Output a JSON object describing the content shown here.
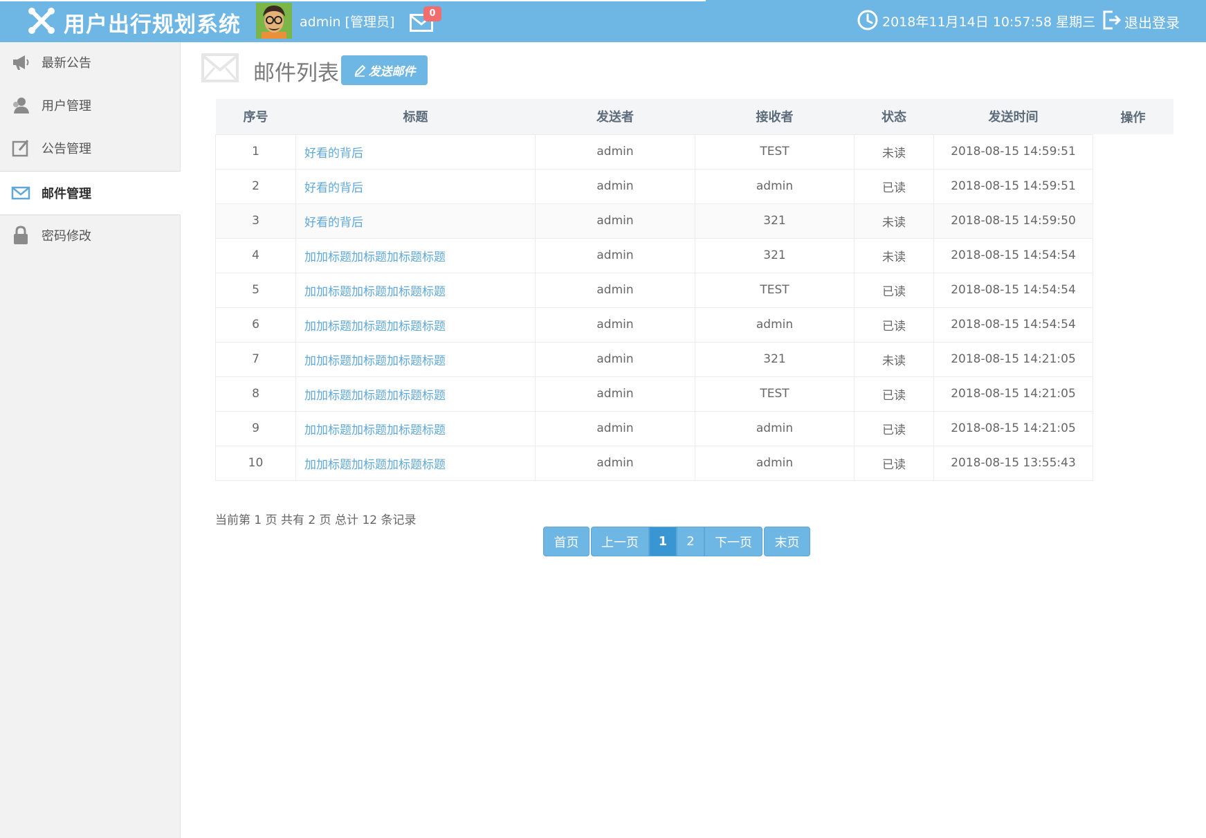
{
  "header": {
    "app_title": "用户出行规划系统",
    "username": "admin [管理员]",
    "mail_count": "0",
    "datetime": "2018年11月14日 10:57:58 星期三",
    "logout_label": "退出登录"
  },
  "sidebar": {
    "items": [
      {
        "label": "最新公告",
        "icon": "megaphone-icon"
      },
      {
        "label": "用户管理",
        "icon": "user-icon"
      },
      {
        "label": "公告管理",
        "icon": "edit-icon"
      },
      {
        "label": "邮件管理",
        "icon": "mail-icon",
        "active": true
      },
      {
        "label": "密码修改",
        "icon": "lock-icon"
      }
    ]
  },
  "main": {
    "title": "邮件列表",
    "send_button": "发送邮件",
    "table": {
      "headers": [
        "序号",
        "标题",
        "发送者",
        "接收者",
        "状态",
        "发送时间",
        "操作"
      ],
      "rows": [
        {
          "no": "1",
          "title": "好看的背后",
          "sender": "admin",
          "receiver": "TEST",
          "status": "未读",
          "time": "2018-08-15 14:59:51"
        },
        {
          "no": "2",
          "title": "好看的背后",
          "sender": "admin",
          "receiver": "admin",
          "status": "已读",
          "time": "2018-08-15 14:59:51"
        },
        {
          "no": "3",
          "title": "好看的背后",
          "sender": "admin",
          "receiver": "321",
          "status": "未读",
          "time": "2018-08-15 14:59:50"
        },
        {
          "no": "4",
          "title": "加加标题加标题加标题标题",
          "sender": "admin",
          "receiver": "321",
          "status": "未读",
          "time": "2018-08-15 14:54:54"
        },
        {
          "no": "5",
          "title": "加加标题加标题加标题标题",
          "sender": "admin",
          "receiver": "TEST",
          "status": "已读",
          "time": "2018-08-15 14:54:54"
        },
        {
          "no": "6",
          "title": "加加标题加标题加标题标题",
          "sender": "admin",
          "receiver": "admin",
          "status": "已读",
          "time": "2018-08-15 14:54:54"
        },
        {
          "no": "7",
          "title": "加加标题加标题加标题标题",
          "sender": "admin",
          "receiver": "321",
          "status": "未读",
          "time": "2018-08-15 14:21:05"
        },
        {
          "no": "8",
          "title": "加加标题加标题加标题标题",
          "sender": "admin",
          "receiver": "TEST",
          "status": "已读",
          "time": "2018-08-15 14:21:05"
        },
        {
          "no": "9",
          "title": "加加标题加标题加标题标题",
          "sender": "admin",
          "receiver": "admin",
          "status": "已读",
          "time": "2018-08-15 14:21:05"
        },
        {
          "no": "10",
          "title": "加加标题加标题加标题标题",
          "sender": "admin",
          "receiver": "admin",
          "status": "已读",
          "time": "2018-08-15 13:55:43"
        }
      ]
    },
    "pagination": {
      "info": "当前第 1 页 共有 2 页 总计 12 条记录",
      "first": "首页",
      "prev": "上一页",
      "pages": [
        "1",
        "2"
      ],
      "current": "1",
      "next": "下一页",
      "last": "末页"
    }
  },
  "colors": {
    "header_bg": "#6eb6e4",
    "link": "#5fa8d8",
    "unread": "#d9342b",
    "current_page": "#3a96d3"
  }
}
